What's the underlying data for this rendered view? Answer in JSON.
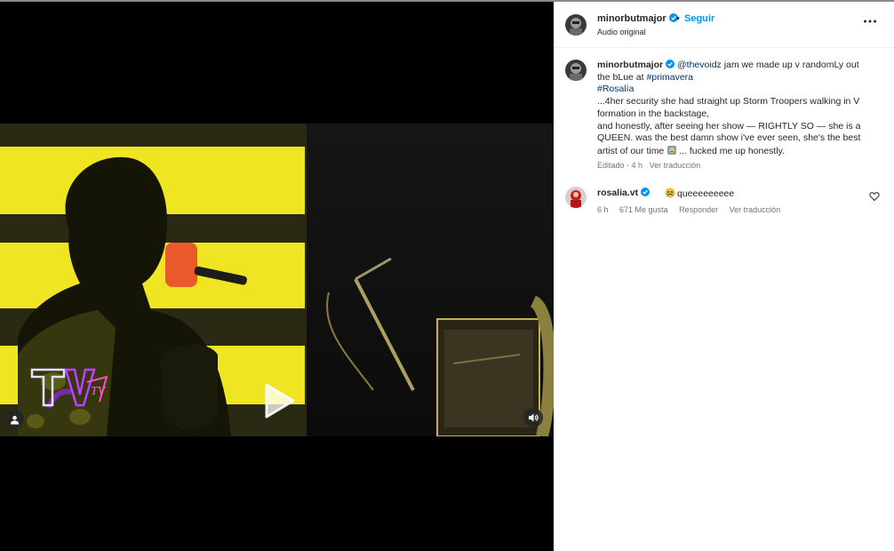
{
  "post": {
    "username": "minorbutmajor",
    "follow_label": "Seguir",
    "separator": "•",
    "audio_label": "Audio original"
  },
  "caption": {
    "username": "minorbutmajor",
    "mention": "@thevoidz",
    "text1": " jam we made up v randomLy out the bLue at ",
    "hashtag1": "#primavera",
    "hashtag2": "#Rosalía",
    "text2": "...4her security she had straight up Storm Troopers walking in V formation in the backstage,",
    "text3": "and honestly, after seeing her show — RIGHTLY SO — she is a QUEEN. was the best damn show i've ever seen, she's the best artist of our time",
    "text4": "... fucked me up honestly.",
    "edited": "Editado · 4 h",
    "translate": "Ver traducción"
  },
  "comments": [
    {
      "username": "rosalia.vt",
      "text": "queeeeeeeee",
      "time": "6 h",
      "likes": "671 Me gusta",
      "reply_label": "Responder",
      "translate": "Ver traducción"
    }
  ],
  "video": {
    "logo_text": "TV"
  },
  "icons": [
    "play-icon",
    "user-tag-icon",
    "audio-icon",
    "more-options-icon",
    "verified-badge-icon",
    "heart-icon",
    "emoji-icon"
  ],
  "colors": {
    "link": "#00376b",
    "follow": "#0095f6",
    "verified": "#0095f6",
    "screen_yellow": "#f0e522"
  }
}
